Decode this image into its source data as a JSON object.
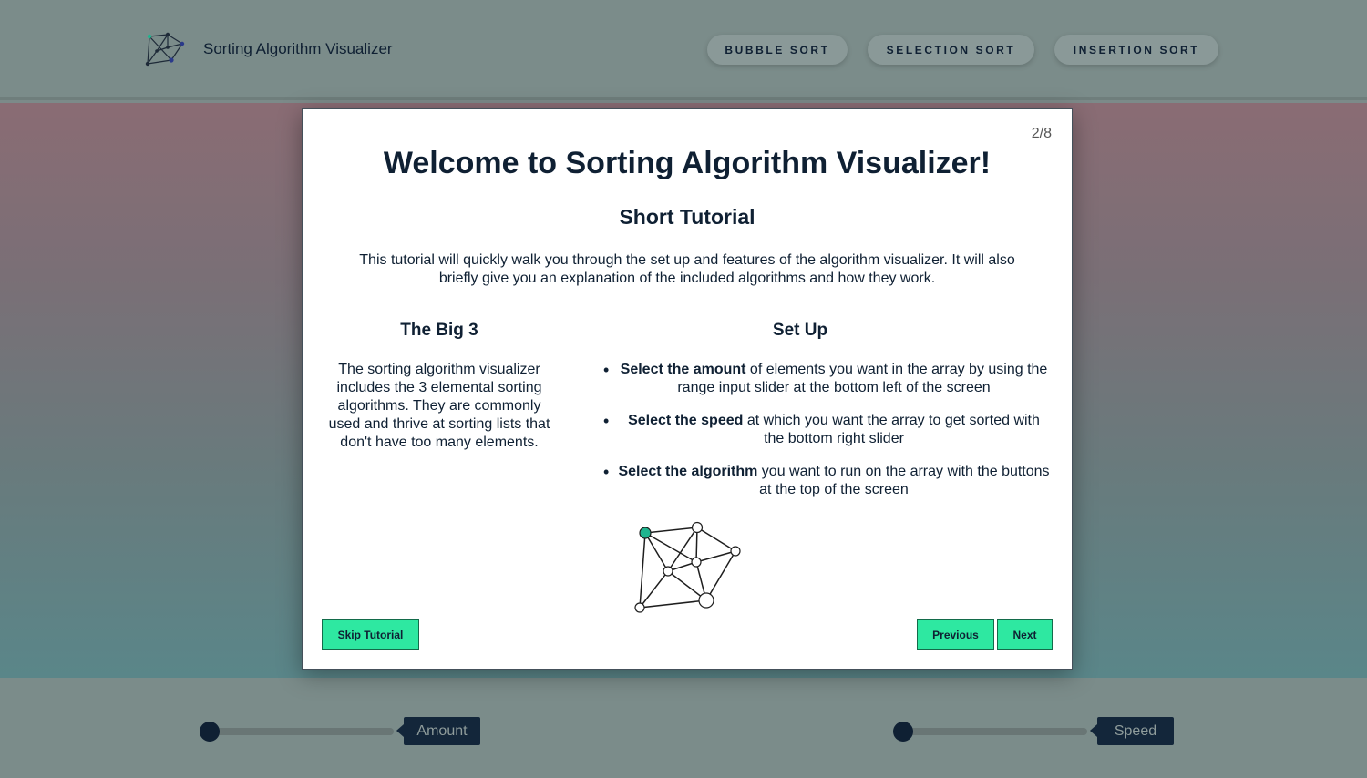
{
  "header": {
    "app_title": "Sorting Algorithm Visualizer",
    "buttons": {
      "bubble": "BUBBLE SORT",
      "selection": "SELECTION SORT",
      "insertion": "INSERTION SORT"
    }
  },
  "footer": {
    "amount_label": "Amount",
    "speed_label": "Speed"
  },
  "modal": {
    "counter": "2/8",
    "title": "Welcome to Sorting Algorithm Visualizer!",
    "subtitle": "Short Tutorial",
    "intro": "This tutorial will quickly walk you through the set up and features of the algorithm visualizer. It will also briefly give you an explanation of the included algorithms and how they work.",
    "left_heading": "The Big 3",
    "left_text": "The sorting algorithm visualizer includes the 3 elemental sorting algorithms. They are commonly used and thrive at sorting lists that don't have too many elements.",
    "right_heading": "Set Up",
    "setup_items": [
      {
        "bold": "Select the amount",
        "rest": " of elements you want in the array by using the range input slider at the bottom left of the screen"
      },
      {
        "bold": "Select the speed",
        "rest": " at which you want the array to get sorted with the bottom right slider"
      },
      {
        "bold": "Select the algorithm",
        "rest": " you want to run on the array with the buttons at the top of the screen"
      }
    ],
    "skip_label": "Skip Tutorial",
    "previous_label": "Previous",
    "next_label": "Next"
  },
  "colors": {
    "accent": "#2ee8a1",
    "navy": "#0f2033",
    "graph_highlight": "#1fb58f"
  }
}
